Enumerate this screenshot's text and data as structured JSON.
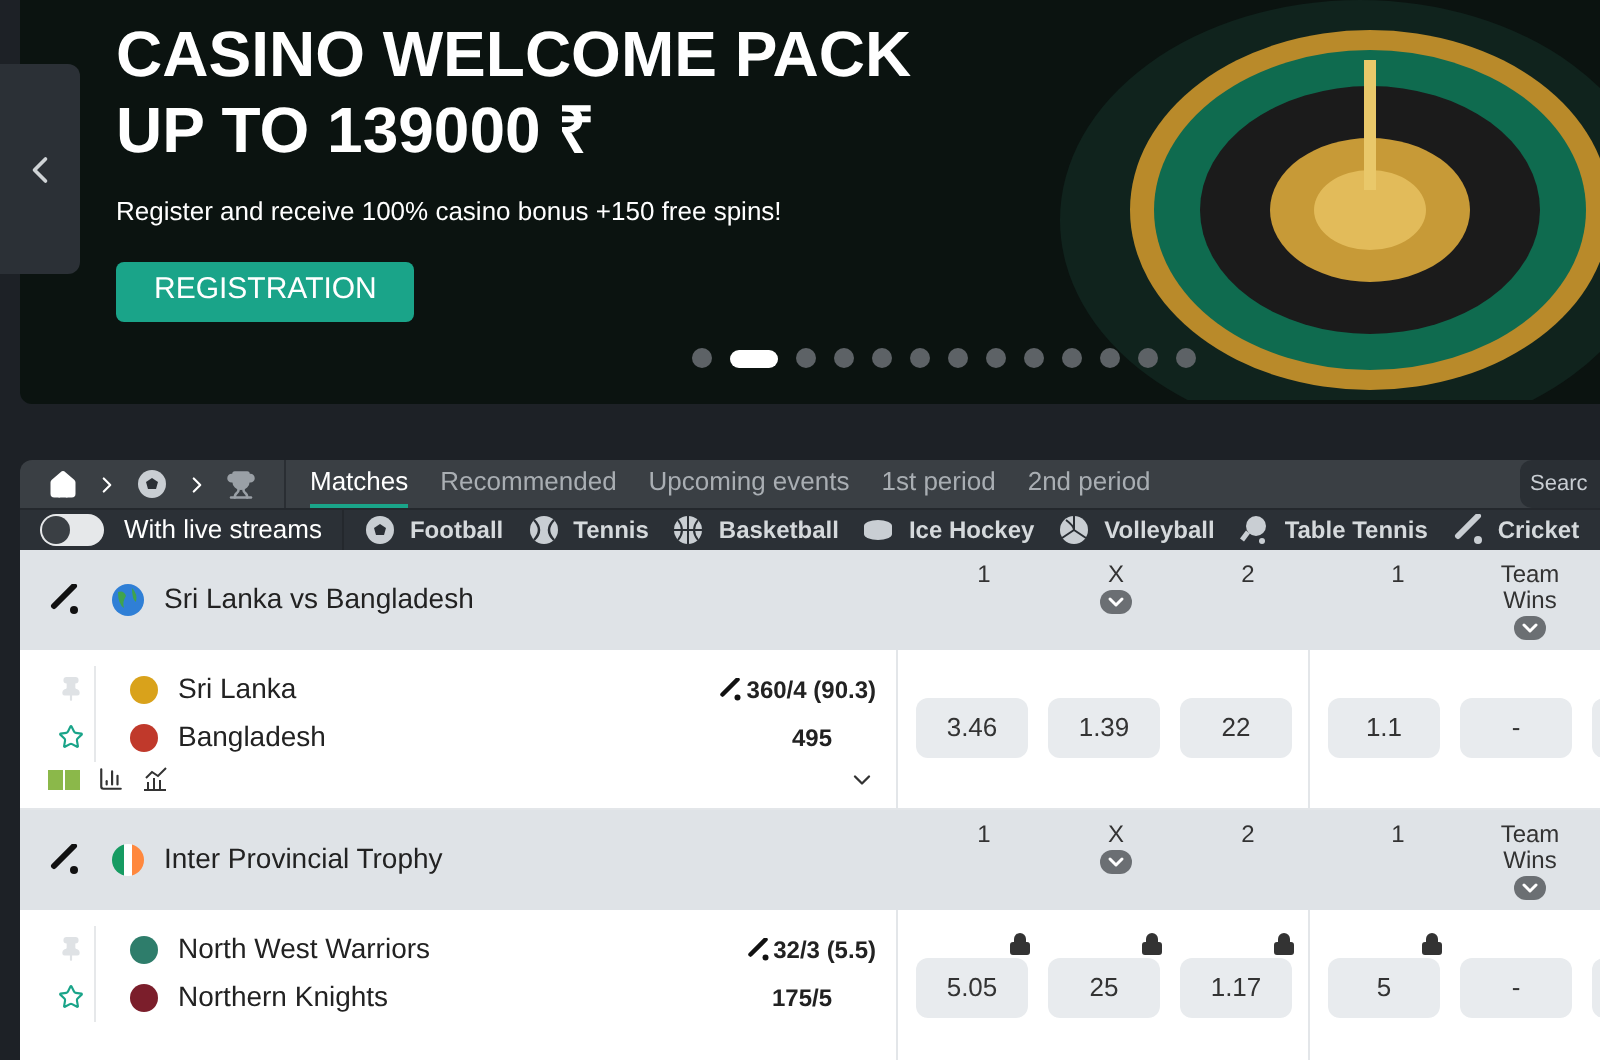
{
  "banner": {
    "title": "CASINO WELCOME PACK UP TO 139000 ₹",
    "subtitle": "Register and receive 100% casino bonus +150 free spins!",
    "button": "REGISTRATION",
    "dots": [
      {
        "selected": false
      },
      {
        "selected": true
      },
      {
        "selected": false
      },
      {
        "selected": false
      },
      {
        "selected": false
      },
      {
        "selected": false
      },
      {
        "selected": false
      },
      {
        "selected": false
      },
      {
        "selected": false
      },
      {
        "selected": false
      },
      {
        "selected": false
      },
      {
        "selected": false
      },
      {
        "selected": false
      }
    ]
  },
  "tabs": [
    {
      "label": "Matches",
      "selected": true
    },
    {
      "label": "Recommended",
      "selected": false
    },
    {
      "label": "Upcoming events",
      "selected": false
    },
    {
      "label": "1st period",
      "selected": false
    },
    {
      "label": "2nd period",
      "selected": false
    }
  ],
  "search": {
    "placeholder": "Searc"
  },
  "live_streams": {
    "label": "With live streams",
    "on": false
  },
  "sports": [
    {
      "label": "Football",
      "kind": "football"
    },
    {
      "label": "Tennis",
      "kind": "tennis"
    },
    {
      "label": "Basketball",
      "kind": "basketball"
    },
    {
      "label": "Ice Hockey",
      "kind": "hockey"
    },
    {
      "label": "Volleyball",
      "kind": "volleyball"
    },
    {
      "label": "Table Tennis",
      "kind": "tabletennis"
    },
    {
      "label": "Cricket",
      "kind": "cricket"
    }
  ],
  "leagues": [
    {
      "name": "Sri Lanka vs Bangladesh",
      "kind": "globe",
      "headers": [
        {
          "label": "1",
          "dropdown": false
        },
        {
          "label": "X",
          "dropdown": true
        },
        {
          "label": "2",
          "dropdown": false
        },
        {
          "label": "1",
          "dropdown": false
        },
        {
          "label": "Team Wins",
          "dropdown": true
        }
      ],
      "match": {
        "stats_icons": true,
        "teams": [
          {
            "name": "Sri Lanka",
            "score": "360/4 (90.3)",
            "batting": true,
            "color": "#d9a21b"
          },
          {
            "name": "Bangladesh",
            "score": "495",
            "batting": false,
            "color": "#c0392b"
          }
        ],
        "odds": [
          {
            "value": "3.46",
            "locked": false
          },
          {
            "value": "1.39",
            "locked": false
          },
          {
            "value": "22",
            "locked": false
          },
          {
            "value": "1.1",
            "locked": false
          },
          {
            "value": "-",
            "locked": false
          }
        ]
      }
    },
    {
      "name": "Inter Provincial Trophy",
      "kind": "ireland",
      "headers": [
        {
          "label": "1",
          "dropdown": false
        },
        {
          "label": "X",
          "dropdown": true
        },
        {
          "label": "2",
          "dropdown": false
        },
        {
          "label": "1",
          "dropdown": false
        },
        {
          "label": "Team Wins",
          "dropdown": true
        }
      ],
      "match": {
        "stats_icons": false,
        "teams": [
          {
            "name": "North West Warriors",
            "score": "32/3 (5.5)",
            "batting": true,
            "color": "#2e7d6b"
          },
          {
            "name": "Northern Knights",
            "score": "175/5",
            "batting": false,
            "color": "#7b1e2b"
          }
        ],
        "odds": [
          {
            "value": "5.05",
            "locked": true
          },
          {
            "value": "25",
            "locked": true
          },
          {
            "value": "1.17",
            "locked": true
          },
          {
            "value": "5",
            "locked": true
          },
          {
            "value": "-",
            "locked": false
          }
        ]
      }
    }
  ]
}
